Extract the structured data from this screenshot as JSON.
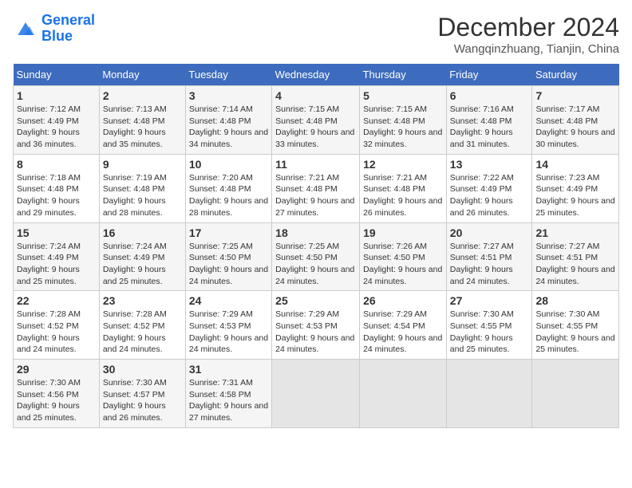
{
  "header": {
    "logo_line1": "General",
    "logo_line2": "Blue",
    "month_title": "December 2024",
    "location": "Wangqinzhuang, Tianjin, China"
  },
  "days_of_week": [
    "Sunday",
    "Monday",
    "Tuesday",
    "Wednesday",
    "Thursday",
    "Friday",
    "Saturday"
  ],
  "weeks": [
    [
      {
        "num": "1",
        "sunrise": "7:12 AM",
        "sunset": "4:49 PM",
        "daylight": "9 hours and 36 minutes."
      },
      {
        "num": "2",
        "sunrise": "7:13 AM",
        "sunset": "4:48 PM",
        "daylight": "9 hours and 35 minutes."
      },
      {
        "num": "3",
        "sunrise": "7:14 AM",
        "sunset": "4:48 PM",
        "daylight": "9 hours and 34 minutes."
      },
      {
        "num": "4",
        "sunrise": "7:15 AM",
        "sunset": "4:48 PM",
        "daylight": "9 hours and 33 minutes."
      },
      {
        "num": "5",
        "sunrise": "7:15 AM",
        "sunset": "4:48 PM",
        "daylight": "9 hours and 32 minutes."
      },
      {
        "num": "6",
        "sunrise": "7:16 AM",
        "sunset": "4:48 PM",
        "daylight": "9 hours and 31 minutes."
      },
      {
        "num": "7",
        "sunrise": "7:17 AM",
        "sunset": "4:48 PM",
        "daylight": "9 hours and 30 minutes."
      }
    ],
    [
      {
        "num": "8",
        "sunrise": "7:18 AM",
        "sunset": "4:48 PM",
        "daylight": "9 hours and 29 minutes."
      },
      {
        "num": "9",
        "sunrise": "7:19 AM",
        "sunset": "4:48 PM",
        "daylight": "9 hours and 28 minutes."
      },
      {
        "num": "10",
        "sunrise": "7:20 AM",
        "sunset": "4:48 PM",
        "daylight": "9 hours and 28 minutes."
      },
      {
        "num": "11",
        "sunrise": "7:21 AM",
        "sunset": "4:48 PM",
        "daylight": "9 hours and 27 minutes."
      },
      {
        "num": "12",
        "sunrise": "7:21 AM",
        "sunset": "4:48 PM",
        "daylight": "9 hours and 26 minutes."
      },
      {
        "num": "13",
        "sunrise": "7:22 AM",
        "sunset": "4:49 PM",
        "daylight": "9 hours and 26 minutes."
      },
      {
        "num": "14",
        "sunrise": "7:23 AM",
        "sunset": "4:49 PM",
        "daylight": "9 hours and 25 minutes."
      }
    ],
    [
      {
        "num": "15",
        "sunrise": "7:24 AM",
        "sunset": "4:49 PM",
        "daylight": "9 hours and 25 minutes."
      },
      {
        "num": "16",
        "sunrise": "7:24 AM",
        "sunset": "4:49 PM",
        "daylight": "9 hours and 25 minutes."
      },
      {
        "num": "17",
        "sunrise": "7:25 AM",
        "sunset": "4:50 PM",
        "daylight": "9 hours and 24 minutes."
      },
      {
        "num": "18",
        "sunrise": "7:25 AM",
        "sunset": "4:50 PM",
        "daylight": "9 hours and 24 minutes."
      },
      {
        "num": "19",
        "sunrise": "7:26 AM",
        "sunset": "4:50 PM",
        "daylight": "9 hours and 24 minutes."
      },
      {
        "num": "20",
        "sunrise": "7:27 AM",
        "sunset": "4:51 PM",
        "daylight": "9 hours and 24 minutes."
      },
      {
        "num": "21",
        "sunrise": "7:27 AM",
        "sunset": "4:51 PM",
        "daylight": "9 hours and 24 minutes."
      }
    ],
    [
      {
        "num": "22",
        "sunrise": "7:28 AM",
        "sunset": "4:52 PM",
        "daylight": "9 hours and 24 minutes."
      },
      {
        "num": "23",
        "sunrise": "7:28 AM",
        "sunset": "4:52 PM",
        "daylight": "9 hours and 24 minutes."
      },
      {
        "num": "24",
        "sunrise": "7:29 AM",
        "sunset": "4:53 PM",
        "daylight": "9 hours and 24 minutes."
      },
      {
        "num": "25",
        "sunrise": "7:29 AM",
        "sunset": "4:53 PM",
        "daylight": "9 hours and 24 minutes."
      },
      {
        "num": "26",
        "sunrise": "7:29 AM",
        "sunset": "4:54 PM",
        "daylight": "9 hours and 24 minutes."
      },
      {
        "num": "27",
        "sunrise": "7:30 AM",
        "sunset": "4:55 PM",
        "daylight": "9 hours and 25 minutes."
      },
      {
        "num": "28",
        "sunrise": "7:30 AM",
        "sunset": "4:55 PM",
        "daylight": "9 hours and 25 minutes."
      }
    ],
    [
      {
        "num": "29",
        "sunrise": "7:30 AM",
        "sunset": "4:56 PM",
        "daylight": "9 hours and 25 minutes."
      },
      {
        "num": "30",
        "sunrise": "7:30 AM",
        "sunset": "4:57 PM",
        "daylight": "9 hours and 26 minutes."
      },
      {
        "num": "31",
        "sunrise": "7:31 AM",
        "sunset": "4:58 PM",
        "daylight": "9 hours and 27 minutes."
      },
      null,
      null,
      null,
      null
    ]
  ]
}
